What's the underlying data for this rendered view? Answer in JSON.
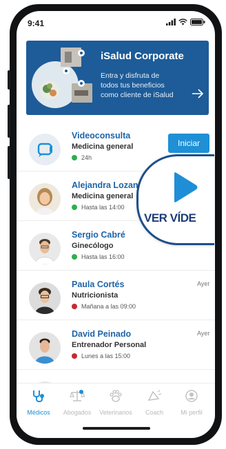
{
  "status_bar": {
    "time": "9:41"
  },
  "banner": {
    "title": "iSalud Corporate",
    "subtitle": "Entra y disfruta de\ntodos tus beneficios\ncomo cliente de iSalud"
  },
  "contacts": [
    {
      "name": "Videoconsulta",
      "role": "Medicina general",
      "availability": "24h",
      "status_color": "#2db04b",
      "action": "Iniciar"
    },
    {
      "name": "Alejandra Lozano",
      "role": "Medicina general",
      "availability": "Hasta las 14:00",
      "status_color": "#2db04b"
    },
    {
      "name": "Sergio Cabré",
      "role": "Ginecólogo",
      "availability": "Hasta las 16:00",
      "status_color": "#2db04b"
    },
    {
      "name": "Paula Cortés",
      "role": "Nutricionista",
      "availability": "Mañana a las 09:00",
      "status_color": "#c62a2f",
      "time": "Ayer"
    },
    {
      "name": "David Peinado",
      "role": "Entrenador Personal",
      "availability": "Lunes a las 15:00",
      "status_color": "#c62a2f",
      "time": "Ayer"
    }
  ],
  "video_overlay": {
    "label": "VER VÍDE"
  },
  "tabs": [
    {
      "label": "Médicos",
      "icon": "stethoscope-icon",
      "active": true
    },
    {
      "label": "Abogados",
      "icon": "scales-icon"
    },
    {
      "label": "Veterinarios",
      "icon": "paw-icon"
    },
    {
      "label": "Coach",
      "icon": "megaphone-icon"
    },
    {
      "label": "Mi perfil",
      "icon": "profile-icon"
    }
  ],
  "colors": {
    "brand": "#1d5c98",
    "accent": "#1e90d6",
    "name": "#1e64a8"
  }
}
